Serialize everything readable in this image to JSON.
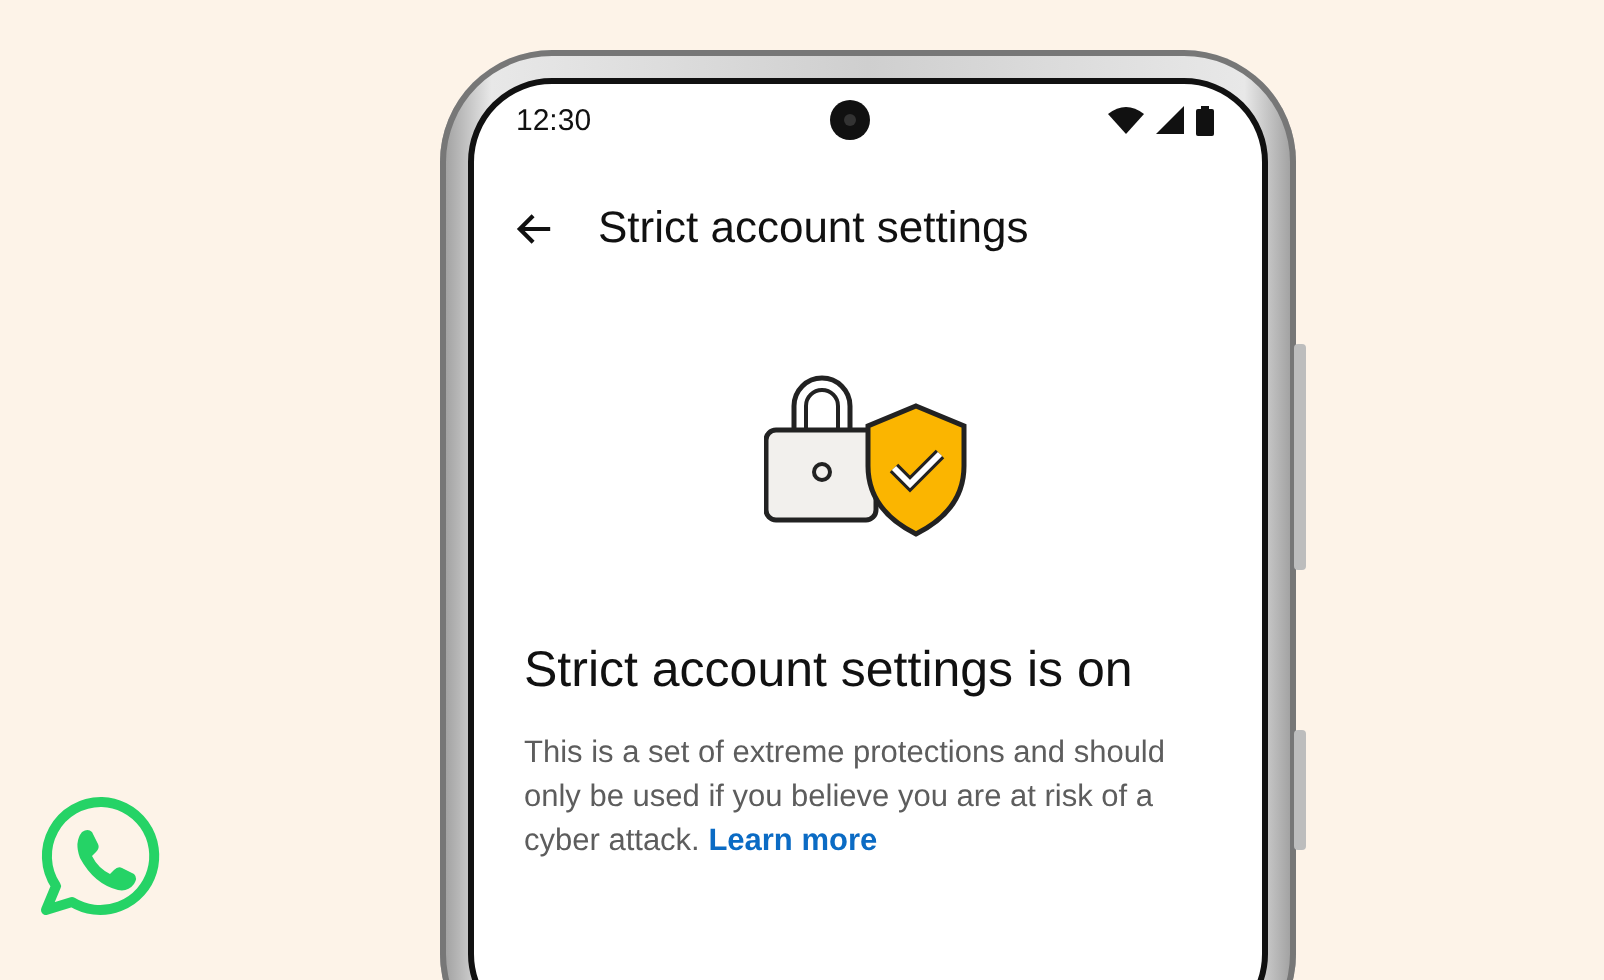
{
  "status_bar": {
    "time": "12:30"
  },
  "app_bar": {
    "title": "Strict account settings"
  },
  "content": {
    "heading": "Strict account settings is on",
    "body": "This is a set of extreme protections and should only be used if you believe you are at risk of a cyber attack.",
    "link": "Learn more"
  }
}
